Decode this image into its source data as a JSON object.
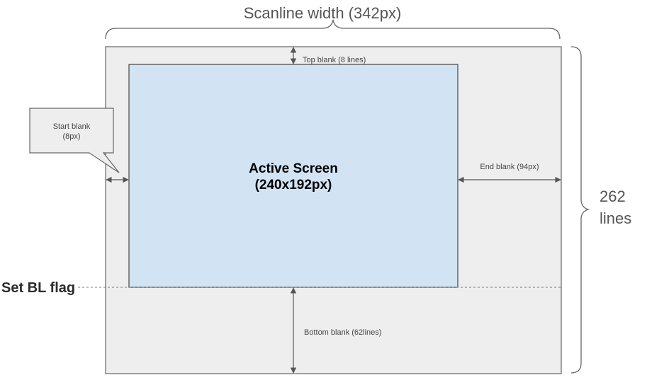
{
  "scanline_label": "Scanline width (342px)",
  "lines_label": {
    "line1": "262",
    "line2": "lines"
  },
  "active_screen": {
    "line1": "Active Screen",
    "line2": "(240x192px)"
  },
  "top_blank": "Top blank (8 lines)",
  "start_blank": {
    "line1": "Start blank",
    "line2": "(8px)"
  },
  "end_blank": "End blank (94px)",
  "bottom_blank": "Bottom blank (62lines)",
  "set_bl_flag": "Set BL flag",
  "colors": {
    "outer_fill": "#eeeeee",
    "outer_stroke": "#666666",
    "active_fill": "#d2e3f3",
    "active_stroke": "#444444",
    "arrow": "#555555"
  }
}
